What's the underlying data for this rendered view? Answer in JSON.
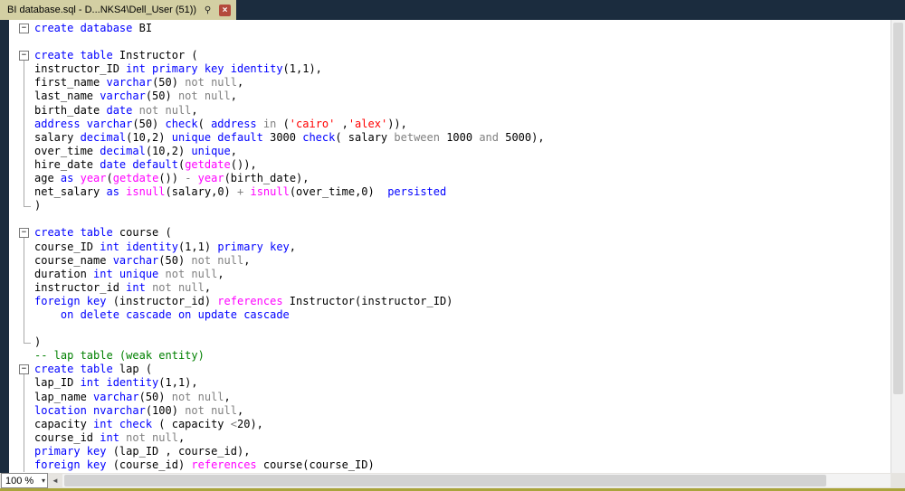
{
  "window": {
    "tab_title": "BI database.sql - D...NKS4\\Dell_User (51))"
  },
  "icons": {
    "pin": "⚲",
    "close": "×",
    "dropdown": "▾",
    "scroll_left": "◄"
  },
  "status": {
    "zoom": "100 %"
  },
  "colors": {
    "chrome": "#1b2c3e",
    "tab": "#d3cfa3",
    "edge": "#aaa43c",
    "kw": "#0000ff",
    "ident": "#000000",
    "op": "#808080",
    "str": "#ff0000",
    "fn": "#ff00ff",
    "com": "#008000"
  },
  "editor": {
    "lines": [
      {
        "fold": "boxonly",
        "tokens": [
          [
            "k",
            "create database "
          ],
          [
            "i",
            "BI"
          ]
        ]
      },
      {
        "fold": "",
        "tokens": []
      },
      {
        "fold": "box",
        "tokens": [
          [
            "k",
            "create table "
          ],
          [
            "i",
            "Instructor ("
          ]
        ]
      },
      {
        "fold": "line",
        "tokens": [
          [
            "i",
            "instructor_ID "
          ],
          [
            "k",
            "int primary key identity"
          ],
          [
            "i",
            "(1,1),"
          ]
        ]
      },
      {
        "fold": "line",
        "tokens": [
          [
            "i",
            "first_name "
          ],
          [
            "k",
            "varchar"
          ],
          [
            "i",
            "(50) "
          ],
          [
            "g",
            "not null"
          ],
          [
            "i",
            ","
          ]
        ]
      },
      {
        "fold": "line",
        "tokens": [
          [
            "i",
            "last_name "
          ],
          [
            "k",
            "varchar"
          ],
          [
            "i",
            "(50) "
          ],
          [
            "g",
            "not null"
          ],
          [
            "i",
            ","
          ]
        ]
      },
      {
        "fold": "line",
        "tokens": [
          [
            "i",
            "birth_date "
          ],
          [
            "k",
            "date "
          ],
          [
            "g",
            "not null"
          ],
          [
            "i",
            ","
          ]
        ]
      },
      {
        "fold": "line",
        "tokens": [
          [
            "k",
            "address varchar"
          ],
          [
            "i",
            "(50) "
          ],
          [
            "k",
            "check"
          ],
          [
            "i",
            "( "
          ],
          [
            "k",
            "address "
          ],
          [
            "g",
            "in "
          ],
          [
            "i",
            "("
          ],
          [
            "s",
            "'cairo'"
          ],
          [
            "i",
            " ,"
          ],
          [
            "s",
            "'alex'"
          ],
          [
            "i",
            ")),"
          ]
        ]
      },
      {
        "fold": "line",
        "tokens": [
          [
            "i",
            "salary "
          ],
          [
            "k",
            "decimal"
          ],
          [
            "i",
            "(10,2) "
          ],
          [
            "k",
            "unique default "
          ],
          [
            "i",
            "3000 "
          ],
          [
            "k",
            "check"
          ],
          [
            "i",
            "( salary "
          ],
          [
            "g",
            "between "
          ],
          [
            "i",
            "1000 "
          ],
          [
            "g",
            "and "
          ],
          [
            "i",
            "5000),"
          ]
        ]
      },
      {
        "fold": "line",
        "tokens": [
          [
            "i",
            "over_time "
          ],
          [
            "k",
            "decimal"
          ],
          [
            "i",
            "(10,2) "
          ],
          [
            "k",
            "unique"
          ],
          [
            "i",
            ","
          ]
        ]
      },
      {
        "fold": "line",
        "tokens": [
          [
            "i",
            "hire_date "
          ],
          [
            "k",
            "date default"
          ],
          [
            "i",
            "("
          ],
          [
            "f",
            "getdate"
          ],
          [
            "i",
            "()),"
          ]
        ]
      },
      {
        "fold": "line",
        "tokens": [
          [
            "i",
            "age "
          ],
          [
            "k",
            "as "
          ],
          [
            "f",
            "year"
          ],
          [
            "i",
            "("
          ],
          [
            "f",
            "getdate"
          ],
          [
            "i",
            "()) "
          ],
          [
            "g",
            "- "
          ],
          [
            "f",
            "year"
          ],
          [
            "i",
            "(birth_date),"
          ]
        ]
      },
      {
        "fold": "line",
        "tokens": [
          [
            "i",
            "net_salary "
          ],
          [
            "k",
            "as "
          ],
          [
            "f",
            "isnull"
          ],
          [
            "i",
            "(salary,0) "
          ],
          [
            "g",
            "+ "
          ],
          [
            "f",
            "isnull"
          ],
          [
            "i",
            "(over_time,0)  "
          ],
          [
            "k",
            "persisted"
          ]
        ]
      },
      {
        "fold": "end",
        "tokens": [
          [
            "i",
            ")"
          ]
        ]
      },
      {
        "fold": "",
        "tokens": []
      },
      {
        "fold": "box",
        "tokens": [
          [
            "k",
            "create table "
          ],
          [
            "i",
            "course ("
          ]
        ]
      },
      {
        "fold": "line",
        "tokens": [
          [
            "i",
            "course_ID "
          ],
          [
            "k",
            "int identity"
          ],
          [
            "i",
            "(1,1) "
          ],
          [
            "k",
            "primary key"
          ],
          [
            "i",
            ","
          ]
        ]
      },
      {
        "fold": "line",
        "tokens": [
          [
            "i",
            "course_name "
          ],
          [
            "k",
            "varchar"
          ],
          [
            "i",
            "(50) "
          ],
          [
            "g",
            "not null"
          ],
          [
            "i",
            ","
          ]
        ]
      },
      {
        "fold": "line",
        "tokens": [
          [
            "i",
            "duration "
          ],
          [
            "k",
            "int unique "
          ],
          [
            "g",
            "not null"
          ],
          [
            "i",
            ","
          ]
        ]
      },
      {
        "fold": "line",
        "tokens": [
          [
            "i",
            "instructor_id "
          ],
          [
            "k",
            "int "
          ],
          [
            "g",
            "not null"
          ],
          [
            "i",
            ","
          ]
        ]
      },
      {
        "fold": "line",
        "tokens": [
          [
            "k",
            "foreign key "
          ],
          [
            "i",
            "(instructor_id) "
          ],
          [
            "f",
            "references "
          ],
          [
            "i",
            "Instructor(instructor_ID)"
          ]
        ]
      },
      {
        "fold": "line",
        "tokens": [
          [
            "i",
            "    "
          ],
          [
            "k",
            "on delete cascade on update cascade"
          ]
        ]
      },
      {
        "fold": "line",
        "tokens": []
      },
      {
        "fold": "end",
        "tokens": [
          [
            "i",
            ")"
          ]
        ]
      },
      {
        "fold": "",
        "tokens": [
          [
            "c",
            "-- lap table (weak entity)"
          ]
        ]
      },
      {
        "fold": "box",
        "tokens": [
          [
            "k",
            "create table "
          ],
          [
            "i",
            "lap ("
          ]
        ]
      },
      {
        "fold": "line",
        "tokens": [
          [
            "i",
            "lap_ID "
          ],
          [
            "k",
            "int identity"
          ],
          [
            "i",
            "(1,1),"
          ]
        ]
      },
      {
        "fold": "line",
        "tokens": [
          [
            "i",
            "lap_name "
          ],
          [
            "k",
            "varchar"
          ],
          [
            "i",
            "(50) "
          ],
          [
            "g",
            "not null"
          ],
          [
            "i",
            ","
          ]
        ]
      },
      {
        "fold": "line",
        "tokens": [
          [
            "k",
            "location nvarchar"
          ],
          [
            "i",
            "(100) "
          ],
          [
            "g",
            "not null"
          ],
          [
            "i",
            ","
          ]
        ]
      },
      {
        "fold": "line",
        "tokens": [
          [
            "i",
            "capacity "
          ],
          [
            "k",
            "int check "
          ],
          [
            "i",
            "( capacity "
          ],
          [
            "g",
            "<"
          ],
          [
            "i",
            "20),"
          ]
        ]
      },
      {
        "fold": "line",
        "tokens": [
          [
            "i",
            "course_id "
          ],
          [
            "k",
            "int "
          ],
          [
            "g",
            "not null"
          ],
          [
            "i",
            ","
          ]
        ]
      },
      {
        "fold": "line",
        "tokens": [
          [
            "k",
            "primary key "
          ],
          [
            "i",
            "(lap_ID , course_id),"
          ]
        ]
      },
      {
        "fold": "line",
        "tokens": [
          [
            "k",
            "foreign key "
          ],
          [
            "i",
            "(course_id) "
          ],
          [
            "f",
            "references "
          ],
          [
            "i",
            "course(course_ID)"
          ]
        ]
      }
    ]
  }
}
